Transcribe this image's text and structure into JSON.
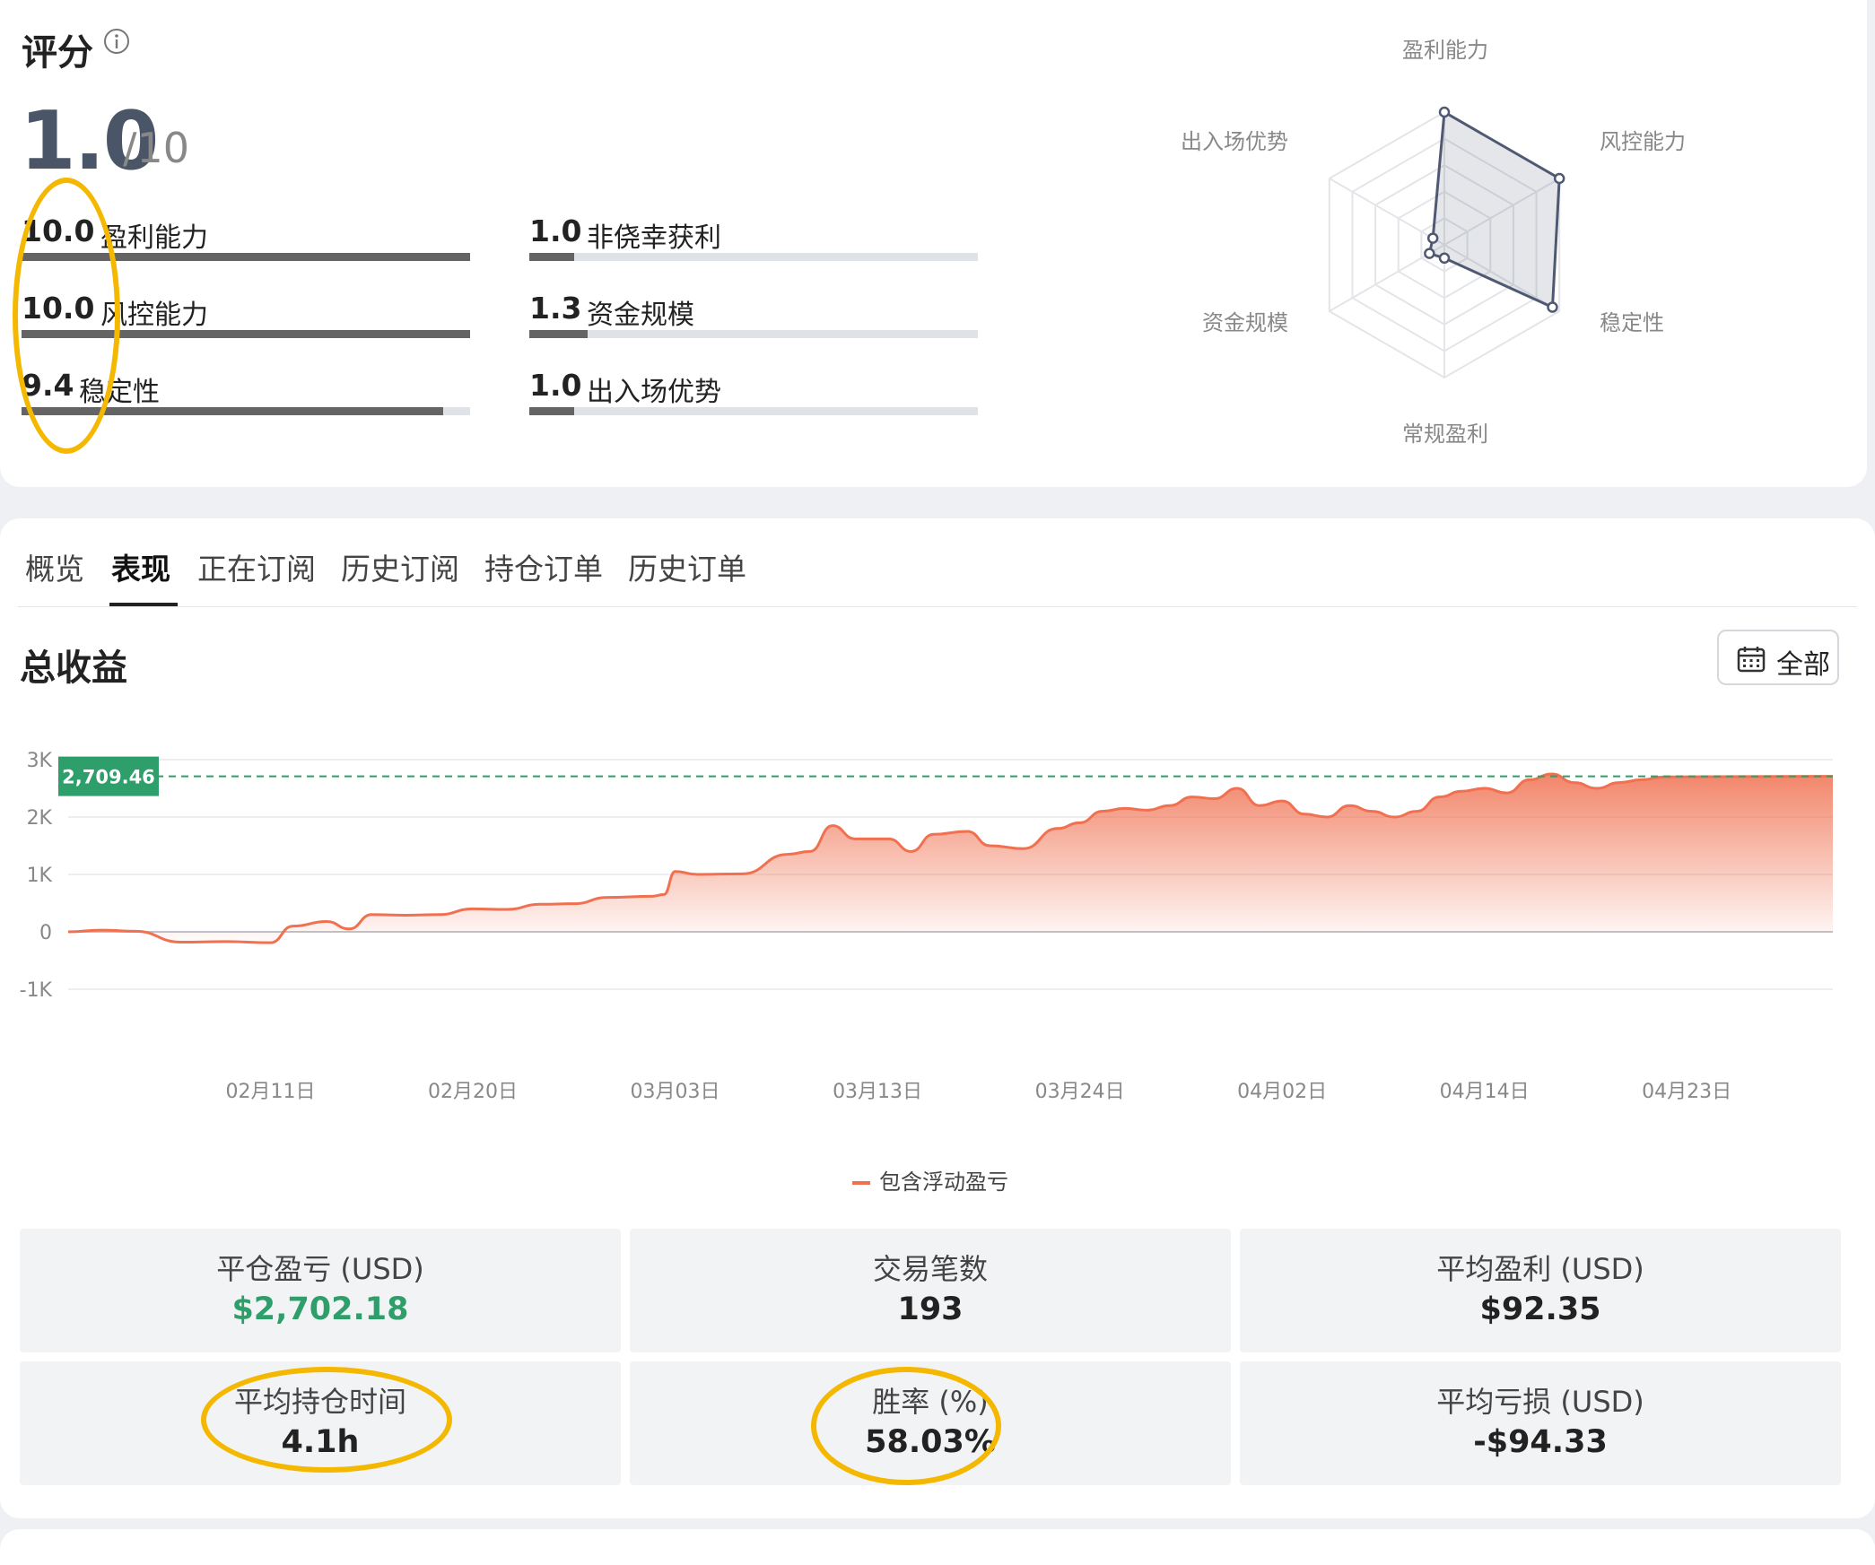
{
  "score": {
    "title": "评分",
    "value": "1.0",
    "max": "/10",
    "metrics": [
      {
        "value": "10.0",
        "label": "盈利能力",
        "level": 1.0
      },
      {
        "value": "1.0",
        "label": "非侥幸获利",
        "level": 0.1
      },
      {
        "value": "10.0",
        "label": "风控能力",
        "level": 1.0
      },
      {
        "value": "1.3",
        "label": "资金规模",
        "level": 0.13
      },
      {
        "value": "9.4",
        "label": "稳定性",
        "level": 0.94
      },
      {
        "value": "1.0",
        "label": "出入场优势",
        "level": 0.1
      }
    ],
    "radar": {
      "axes": [
        "盈利能力",
        "风控能力",
        "稳定性",
        "常规盈利",
        "资金规模",
        "出入场优势"
      ],
      "values": [
        10.0,
        10.0,
        9.4,
        1.0,
        1.3,
        1.0
      ],
      "max": 10
    }
  },
  "tabs": [
    "概览",
    "表现",
    "正在订阅",
    "历史订阅",
    "持仓订单",
    "历史订单"
  ],
  "active_tab": "表现",
  "performance": {
    "title": "总收益",
    "range_label": "全部",
    "legend": "包含浮动盈亏",
    "colors": {
      "series": "#f07050",
      "marker": "#2e9e6a"
    }
  },
  "chart_data": {
    "type": "area",
    "series": [
      {
        "name": "包含浮动盈亏"
      }
    ],
    "y_ticks": [
      "3K",
      "2K",
      "1K",
      "0",
      "-1K"
    ],
    "ylim": [
      -1000,
      3000
    ],
    "x_ticks": [
      "02月11日",
      "02月20日",
      "03月03日",
      "03月13日",
      "03月24日",
      "04月02日",
      "04月14日",
      "04月23日"
    ],
    "x_tick_positions": [
      9,
      18,
      27,
      36,
      45,
      54,
      63,
      72
    ],
    "x_range": [
      0,
      78.5
    ],
    "current_value_label": "2,709.46",
    "current_value": 2709.46,
    "points": [
      [
        0,
        0
      ],
      [
        1.5,
        30
      ],
      [
        3,
        10
      ],
      [
        5,
        -180
      ],
      [
        7,
        -170
      ],
      [
        9,
        -190
      ],
      [
        10,
        100
      ],
      [
        11.5,
        180
      ],
      [
        12.5,
        50
      ],
      [
        13.5,
        300
      ],
      [
        15,
        290
      ],
      [
        16.5,
        300
      ],
      [
        18,
        400
      ],
      [
        19.5,
        390
      ],
      [
        21,
        480
      ],
      [
        22.5,
        490
      ],
      [
        24,
        600
      ],
      [
        26,
        620
      ],
      [
        26.5,
        650
      ],
      [
        27,
        1050
      ],
      [
        28,
        1000
      ],
      [
        30,
        1010
      ],
      [
        32,
        1350
      ],
      [
        33,
        1400
      ],
      [
        34,
        1850
      ],
      [
        35,
        1620
      ],
      [
        36.5,
        1620
      ],
      [
        37.5,
        1400
      ],
      [
        38.5,
        1700
      ],
      [
        40,
        1750
      ],
      [
        41,
        1500
      ],
      [
        42.5,
        1450
      ],
      [
        44,
        1800
      ],
      [
        45,
        1900
      ],
      [
        46,
        2100
      ],
      [
        47,
        2150
      ],
      [
        48,
        2120
      ],
      [
        49,
        2200
      ],
      [
        50,
        2350
      ],
      [
        51,
        2320
      ],
      [
        52,
        2500
      ],
      [
        53,
        2200
      ],
      [
        54,
        2280
      ],
      [
        55,
        2050
      ],
      [
        56,
        2000
      ],
      [
        57,
        2200
      ],
      [
        58,
        2100
      ],
      [
        59,
        2000
      ],
      [
        60,
        2100
      ],
      [
        61,
        2350
      ],
      [
        62,
        2450
      ],
      [
        63,
        2500
      ],
      [
        64,
        2420
      ],
      [
        65,
        2650
      ],
      [
        66,
        2750
      ],
      [
        67,
        2600
      ],
      [
        68,
        2500
      ],
      [
        69,
        2600
      ],
      [
        70,
        2650
      ],
      [
        71,
        2700
      ],
      [
        78.5,
        2709.46
      ]
    ]
  },
  "stats": [
    {
      "label": "平仓盈亏 (USD)",
      "value": "$2,702.18",
      "positive": true
    },
    {
      "label": "交易笔数",
      "value": "193"
    },
    {
      "label": "平均盈利 (USD)",
      "value": "$92.35"
    },
    {
      "label": "平均持仓时间",
      "value": "4.1h"
    },
    {
      "label": "胜率 (%)",
      "value": "58.03%"
    },
    {
      "label": "平均亏损 (USD)",
      "value": "-$94.33"
    }
  ]
}
